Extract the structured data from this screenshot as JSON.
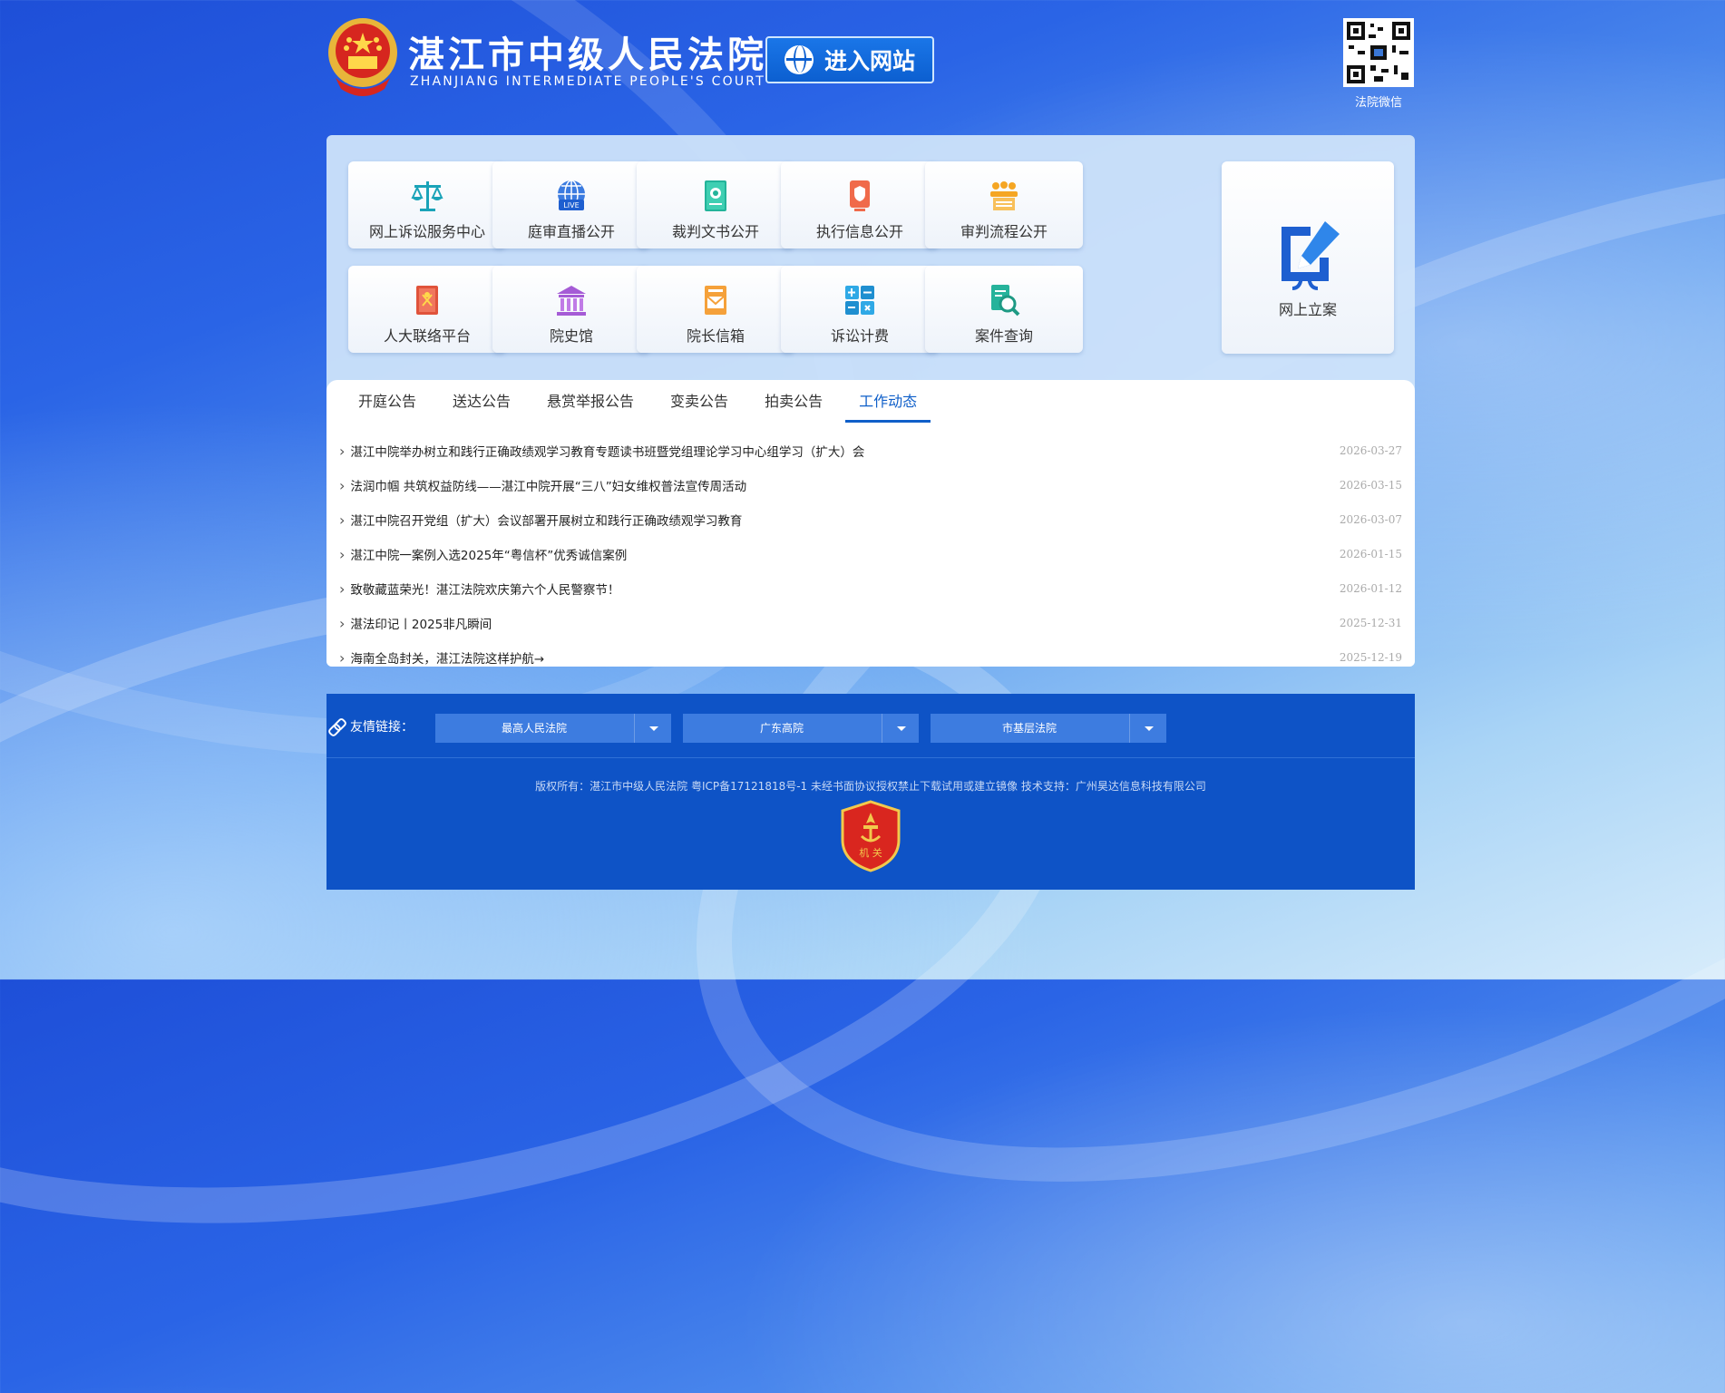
{
  "header": {
    "title": "湛江市中级人民法院",
    "subtitle": "ZHANJIANG INTERMEDIATE PEOPLE'S COURT",
    "enter_label": "进入网站",
    "qr_label": "法院微信"
  },
  "services": [
    {
      "label": "网上诉讼服务中心",
      "icon": "scales-icon"
    },
    {
      "label": "庭审直播公开",
      "icon": "live-globe-icon"
    },
    {
      "label": "裁判文书公开",
      "icon": "document-icon"
    },
    {
      "label": "执行信息公开",
      "icon": "shield-document-icon"
    },
    {
      "label": "审判流程公开",
      "icon": "people-desk-icon"
    },
    {
      "label": "人大联络平台",
      "icon": "red-book-icon"
    },
    {
      "label": "院史馆",
      "icon": "museum-icon"
    },
    {
      "label": "院长信箱",
      "icon": "mail-icon"
    },
    {
      "label": "诉讼计费",
      "icon": "calculator-icon"
    },
    {
      "label": "案件查询",
      "icon": "search-document-icon"
    }
  ],
  "big_service": {
    "label": "网上立案",
    "icon": "pen-icon"
  },
  "tabs": [
    "开庭公告",
    "送达公告",
    "悬赏举报公告",
    "变卖公告",
    "拍卖公告",
    "工作动态"
  ],
  "active_tab": "工作动态",
  "news": [
    {
      "title": "湛江中院举办树立和践行正确政绩观学习教育专题读书班暨党组理论学习中心组学习（扩大）会",
      "date": "2026-03-27"
    },
    {
      "title": "法润巾帼 共筑权益防线——湛江中院开展“三八”妇女维权普法宣传周活动",
      "date": "2026-03-15"
    },
    {
      "title": "湛江中院召开党组（扩大）会议部署开展树立和践行正确政绩观学习教育",
      "date": "2026-03-07"
    },
    {
      "title": "湛江中院一案例入选2025年“粤信杯”优秀诚信案例",
      "date": "2026-01-15"
    },
    {
      "title": "致敬藏蓝荣光！湛江法院欢庆第六个人民警察节！",
      "date": "2026-01-12"
    },
    {
      "title": "湛法印记丨2025非凡瞬间",
      "date": "2025-12-31"
    },
    {
      "title": "海南全岛封关，湛江法院这样护航→",
      "date": "2025-12-19"
    }
  ],
  "links": {
    "label": "友情链接：",
    "selects": [
      "最高人民法院",
      "广东高院",
      "市基层法院"
    ]
  },
  "footer": {
    "copyright": "版权所有：湛江市中级人民法院 粤ICP备17121818号-1 未经书面协议授权禁止下载试用或建立镜像 技术支持：广州昊达信息科技有限公司",
    "badge_text": "机 关"
  }
}
